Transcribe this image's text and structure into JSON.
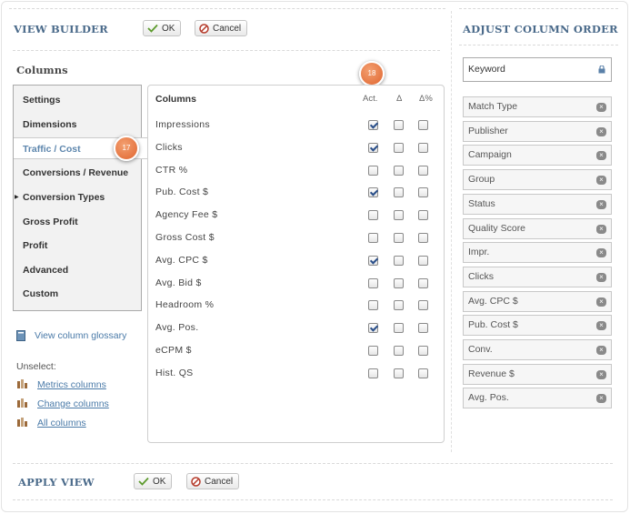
{
  "view_builder": {
    "title": "VIEW BUILDER",
    "ok_label": "OK",
    "cancel_label": "Cancel"
  },
  "apply_view": {
    "title": "APPLY VIEW",
    "ok_label": "OK",
    "cancel_label": "Cancel"
  },
  "columns_heading": "Columns",
  "categories": [
    {
      "label": "Settings"
    },
    {
      "label": "Dimensions"
    },
    {
      "label": "Traffic / Cost"
    },
    {
      "label": "Conversions / Revenue"
    },
    {
      "label": "Conversion Types"
    },
    {
      "label": "Gross Profit"
    },
    {
      "label": "Profit"
    },
    {
      "label": "Advanced"
    },
    {
      "label": "Custom"
    }
  ],
  "active_category": "Traffic / Cost",
  "badges": {
    "b17": "17",
    "b18": "18"
  },
  "main": {
    "heading": "Columns",
    "col_act": "Act.",
    "col_delta": "Δ",
    "col_delta_pct": "Δ%",
    "rows": [
      {
        "label": "Impressions",
        "act": true,
        "delta": false,
        "delta_pct": false
      },
      {
        "label": "Clicks",
        "act": true,
        "delta": false,
        "delta_pct": false
      },
      {
        "label": "CTR %",
        "act": false,
        "delta": false,
        "delta_pct": false
      },
      {
        "label": "Pub. Cost $",
        "act": true,
        "delta": false,
        "delta_pct": false
      },
      {
        "label": "Agency Fee $",
        "act": false,
        "delta": false,
        "delta_pct": false
      },
      {
        "label": "Gross Cost $",
        "act": false,
        "delta": false,
        "delta_pct": false
      },
      {
        "label": "Avg. CPC $",
        "act": true,
        "delta": false,
        "delta_pct": false
      },
      {
        "label": "Avg. Bid $",
        "act": false,
        "delta": false,
        "delta_pct": false
      },
      {
        "label": "Headroom %",
        "act": false,
        "delta": false,
        "delta_pct": false
      },
      {
        "label": "Avg. Pos.",
        "act": true,
        "delta": false,
        "delta_pct": false
      },
      {
        "label": "eCPM $",
        "act": false,
        "delta": false,
        "delta_pct": false
      },
      {
        "label": "Hist. QS",
        "act": false,
        "delta": false,
        "delta_pct": false
      }
    ]
  },
  "glossary_link": "View column glossary",
  "unselect": {
    "label": "Unselect:",
    "metrics": "Metrics columns",
    "change": "Change columns",
    "all": "All columns"
  },
  "adjust_order": {
    "title": "ADJUST COLUMN ORDER",
    "locked_item": "Keyword",
    "items": [
      "Match Type",
      "Publisher",
      "Campaign",
      "Group",
      "Status",
      "Quality Score",
      "Impr.",
      "Clicks",
      "Avg. CPC $",
      "Pub. Cost $",
      "Conv.",
      "Revenue $",
      "Avg. Pos."
    ]
  },
  "colors": {
    "title_blue": "#4a6a8a",
    "link_blue": "#4a7aa8",
    "badge_orange": "#e0652f",
    "check_blue": "#2a4f8a"
  }
}
